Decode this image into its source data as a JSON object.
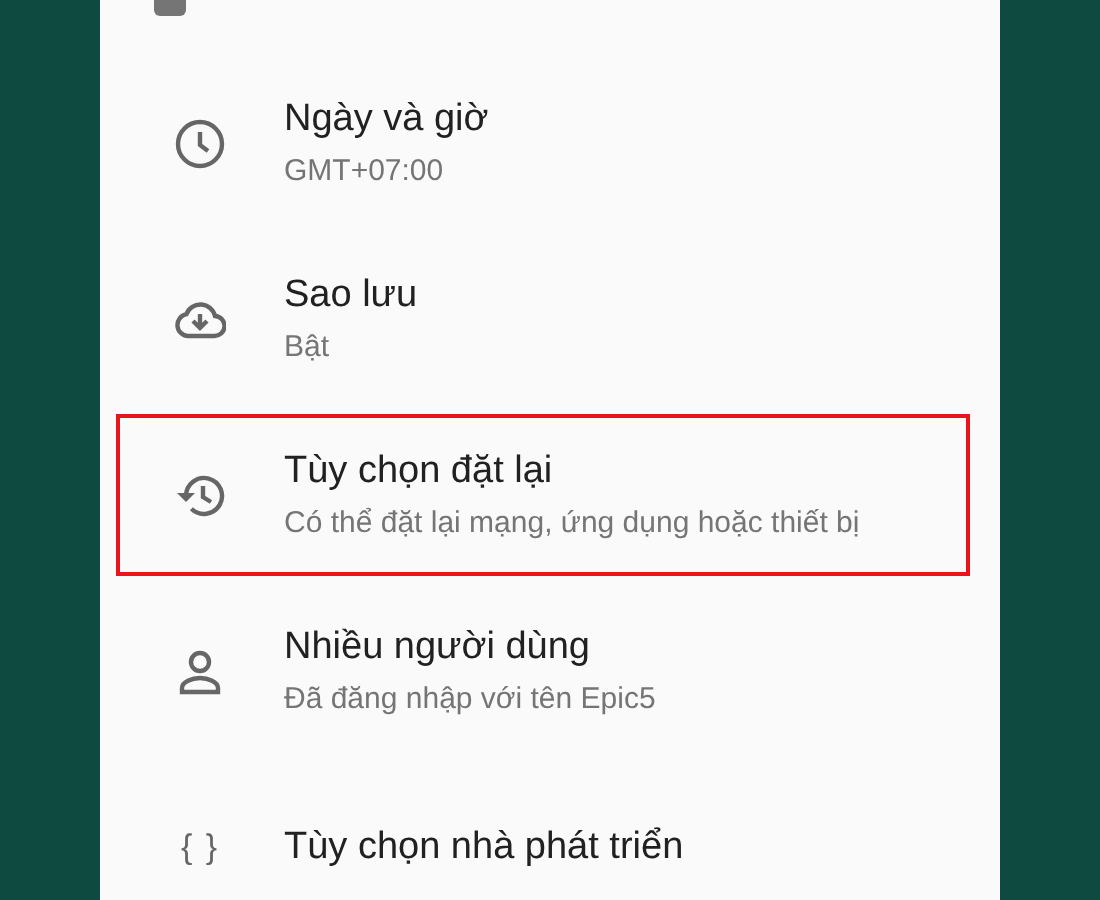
{
  "settings": {
    "items": [
      {
        "title": "Ngày và giờ",
        "summary": "GMT+07:00",
        "highlighted": false
      },
      {
        "title": "Sao lưu",
        "summary": "Bật",
        "highlighted": false
      },
      {
        "title": "Tùy chọn đặt lại",
        "summary": "Có thể đặt lại mạng, ứng dụng hoặc thiết bị",
        "highlighted": true
      },
      {
        "title": "Nhiều người dùng",
        "summary": "Đã đăng nhập với tên Epic5",
        "highlighted": false
      },
      {
        "icon_text": "{ }",
        "title": "Tùy chọn nhà phát triển",
        "highlighted": false
      }
    ]
  }
}
